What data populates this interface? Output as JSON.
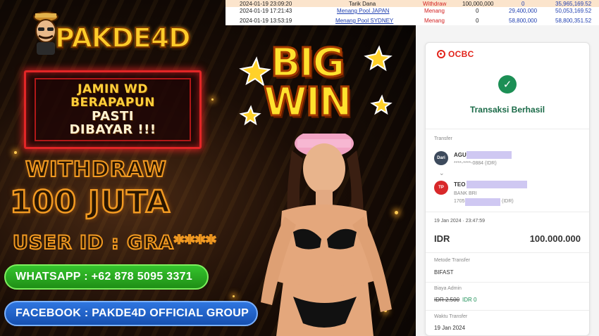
{
  "colors": {
    "accent_orange": "#f29a22",
    "whatsapp_green": "#2fb326",
    "facebook_blue": "#2366cc",
    "ocbc_red": "#e2231a",
    "success_green": "#1c8f55"
  },
  "banner": {
    "logo": "PAKDE4D",
    "jamin_lines": [
      "JAMIN WD",
      "BERAPAPUN",
      "PASTI",
      "DIBAYAR !!!"
    ],
    "withdraw_label": "WITHDRAW",
    "withdraw_amount": "100 JUTA",
    "user_id": "USER ID : GRA****",
    "whatsapp": "WHATSAPP : +62 878 5095 3371",
    "facebook": "FACEBOOK : PAKDE4D OFFICIAL GROUP",
    "big_win": [
      "BIG",
      "WIN"
    ]
  },
  "ledger": {
    "rows": [
      {
        "date": "2024-01-19 23:09:20",
        "desc": "Tarik Dana",
        "status": "Withdraw",
        "debit": "100,000,000",
        "credit": "0",
        "balance": "35,965,169.52"
      },
      {
        "date": "2024-01-19 17:21:43",
        "desc": "Menang Pool JAPAN",
        "status": "Menang",
        "debit": "0",
        "credit": "29,400,000",
        "balance": "50,053,169.52"
      },
      {
        "date": "2024-01-19 13:53:19",
        "desc": "Menang Pool SYDNEY",
        "status": "Menang",
        "debit": "0",
        "credit": "58,800,000",
        "balance": "58,800,351.52"
      }
    ]
  },
  "receipt": {
    "bank": "OCBC",
    "status": "Transaksi Berhasil",
    "transfer_label": "Transfer",
    "from_avatar": "Dari",
    "from_name": "AGU",
    "from_account": "****-****-0884 (IDR)",
    "to_avatar": "TP",
    "to_name": "TEO",
    "to_bank": "BANK BRI",
    "to_account_prefix": "1705",
    "to_account_suffix": "(IDR)",
    "datetime": "19 Jan 2024 · 23:47:59",
    "currency": "IDR",
    "amount": "100.000.000",
    "method_label": "Metode Transfer",
    "method": "BIFAST",
    "fee_label": "Biaya Admin",
    "fee_old": "IDR 2.500",
    "fee_new": "IDR 0",
    "time_label": "Waktu Transfer",
    "time": "19 Jan 2024"
  }
}
